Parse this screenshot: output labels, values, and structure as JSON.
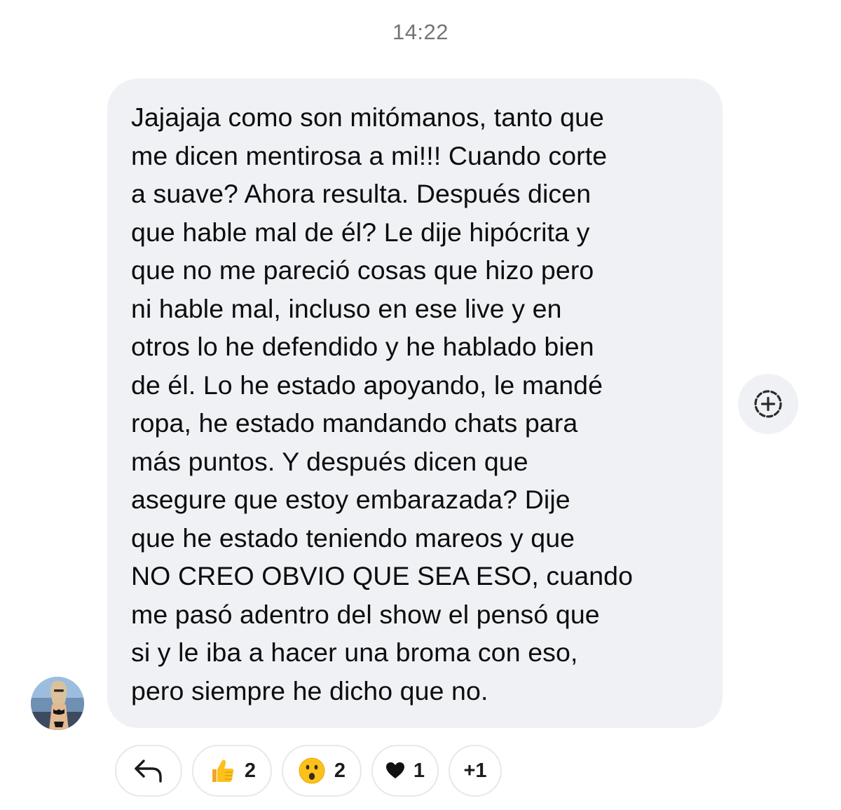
{
  "timestamp": "14:22",
  "message": {
    "text": "Jajajaja como son mitómanos, tanto que\nme dicen mentirosa a mi!!! Cuando corte\na suave? Ahora resulta. Después dicen\nque hable mal de él? Le dije hipócrita y\nque no me pareció cosas que hizo pero\nni hable mal, incluso en ese live y en\notros lo he defendido y he hablado bien\nde él. Lo he estado apoyando, le mandé\nropa, he estado mandando chats para\nmás puntos. Y después dicen que\nasegure que estoy embarazada? Dije\nque he estado teniendo mareos y que\nNO CREO OBVIO QUE SEA ESO, cuando\nme pasó adentro del show el pensó que\nsi y le iba a hacer una broma con eso,\npero siempre he dicho que no.",
    "bubble_color": "#eff1f5"
  },
  "reactions": {
    "thumbs_up": {
      "icon": "thumbs-up-emoji",
      "count": "2"
    },
    "wow": {
      "icon": "surprised-face-emoji",
      "count": "2"
    },
    "heart": {
      "icon": "black-heart-icon",
      "count": "1"
    },
    "more": {
      "label": "+1"
    }
  },
  "icons": {
    "reply": "reply-arrow-icon",
    "add_reaction": "add-reaction-icon",
    "avatar": "sender-avatar"
  }
}
